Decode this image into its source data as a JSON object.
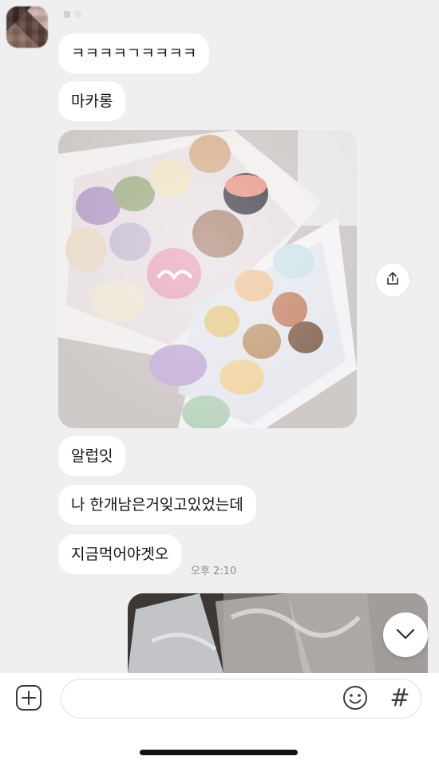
{
  "chat": {
    "messages": [
      {
        "text": "ㅋㅋㅋㅋㄱㅋㅋㅋㅋ"
      },
      {
        "text": "마카롱"
      },
      {
        "text": "알럽잇"
      },
      {
        "text": "나 한개남은거잊고있었는데"
      },
      {
        "text": "지금먹어야겟오"
      }
    ],
    "timestamp": "오후 2:10"
  },
  "icons": {
    "share": "share-icon",
    "scroll_down": "chevron-down-icon",
    "add": "plus-square-icon",
    "emoji": "smiley-icon",
    "hashtag": "#"
  },
  "input": {
    "placeholder": ""
  },
  "colors": {
    "background": "#efeff1",
    "bubble": "#ffffff",
    "timestamp": "#8b8b8f"
  }
}
